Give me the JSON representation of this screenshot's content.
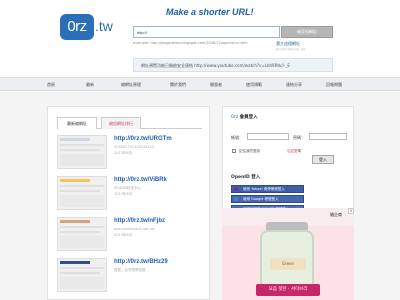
{
  "header": {
    "logo_main": "0rz",
    "logo_ext": ".tw",
    "slogan": "Make a shorter URL!",
    "url_input_value": "http://",
    "shorten_button": "縮至短網址",
    "example": "example: http://blogsdemo.blogspot.com/2008/12/openid-in.html",
    "extension_link": "瀏大這個網址",
    "extension_sub": "(((((((((((((((((((( ))))",
    "info_text": "網址預覽功能已開啟安全連結 http://www.youtube.com/watch?v=Lbh9Rtk//-_E"
  },
  "nav": {
    "items": [
      "首頁",
      "最新",
      "縮網址原理",
      "關於我們",
      "開發者",
      "使用規範",
      "連結分享",
      "回報問題"
    ]
  },
  "left": {
    "tabs": [
      "最新縮網址",
      "縮短網址排行"
    ],
    "items": [
      {
        "link": "http://0rz.tw/URGTm",
        "sub": "305003751129132521",
        "date": "2013年6月"
      },
      {
        "link": "http://0rz.tw/ViBRk",
        "sub": "3D4DM科技中心",
        "date": "2013年6月"
      },
      {
        "link": "http://0rz.tw/nFjbz",
        "sub": "openrestaurant.com.tw",
        "date": "2013年6月"
      },
      {
        "link": "http://0rz.tw/BHz29",
        "sub": "首頁 | 台灣寬帶追蹤...",
        "date": ""
      }
    ]
  },
  "right": {
    "login_title_prefix": "0rz",
    "login_title": "會員登入",
    "account_label": "帳號：",
    "password_label": "密碼：",
    "remember_text": "記住我的登錄",
    "forgot_text": "忘記密碼",
    "login_button": "登入",
    "openid_title": "OpenID 登入",
    "openid_buttons": [
      "使用 Yahoo! 奇摩帳號登入",
      "使用 Google 帳號登入",
      "使用痞客邦 PIXNET 帳號登入"
    ]
  },
  "ad": {
    "corner_text": "婚企商",
    "label": "Green",
    "banner": "요즘 핫한 · 셔이브리"
  }
}
